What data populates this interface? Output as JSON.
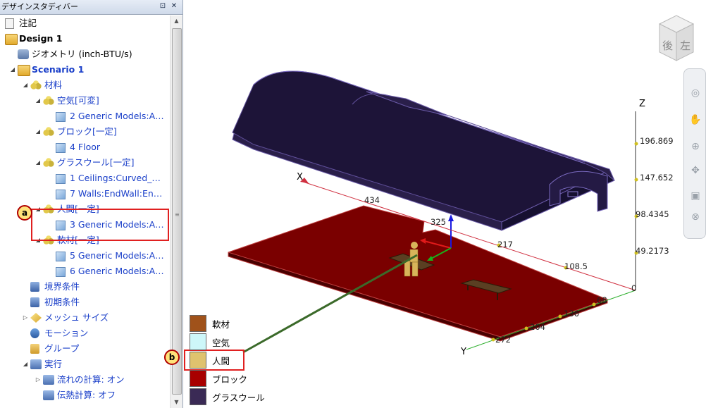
{
  "panel": {
    "title": "デザインスタディバー",
    "pin_icon": "pin-icon",
    "close_icon": "close-icon"
  },
  "tree": [
    {
      "label": "注記",
      "color": "black",
      "bold": false,
      "icon": "note-icon"
    },
    {
      "label": "Design 1",
      "color": "black",
      "bold": true,
      "icon": "design-folder-icon"
    },
    {
      "label": "ジオメトリ (inch-BTU/s)",
      "color": "black",
      "bold": false,
      "icon": "geometry-icon"
    },
    {
      "label": "Scenario 1",
      "color": "blue",
      "bold": true,
      "icon": "scenario-folder-icon"
    },
    {
      "label": "材料",
      "color": "blue",
      "bold": false,
      "icon": "materials-icon"
    },
    {
      "label": "空気[可変]",
      "color": "blue",
      "bold": false,
      "icon": "material-icon"
    },
    {
      "label": "2 Generic Models:A…",
      "color": "blue",
      "bold": false,
      "icon": "part-cube-icon"
    },
    {
      "label": "ブロック[一定]",
      "color": "blue",
      "bold": false,
      "icon": "material-icon"
    },
    {
      "label": "4 Floor",
      "color": "blue",
      "bold": false,
      "icon": "part-cube-icon"
    },
    {
      "label": "グラスウール[一定]",
      "color": "blue",
      "bold": false,
      "icon": "material-icon"
    },
    {
      "label": "1 Ceilings:Curved_…",
      "color": "blue",
      "bold": false,
      "icon": "part-cube-icon"
    },
    {
      "label": "7 Walls:EndWall:En…",
      "color": "blue",
      "bold": false,
      "icon": "part-cube-icon"
    },
    {
      "label": "人間[一定]",
      "color": "blue",
      "bold": false,
      "icon": "material-icon"
    },
    {
      "label": "3 Generic Models:A…",
      "color": "blue",
      "bold": false,
      "icon": "part-cube-icon"
    },
    {
      "label": "軟材[一定]",
      "color": "blue",
      "bold": false,
      "icon": "material-icon"
    },
    {
      "label": "5 Generic Models:A…",
      "color": "blue",
      "bold": false,
      "icon": "part-cube-icon"
    },
    {
      "label": "6 Generic Models:A…",
      "color": "blue",
      "bold": false,
      "icon": "part-cube-icon"
    },
    {
      "label": "境界条件",
      "color": "blue",
      "bold": false,
      "icon": "boundary-conditions-icon"
    },
    {
      "label": "初期条件",
      "color": "blue",
      "bold": false,
      "icon": "initial-conditions-icon"
    },
    {
      "label": "メッシュ サイズ",
      "color": "blue",
      "bold": false,
      "icon": "mesh-size-icon"
    },
    {
      "label": "モーション",
      "color": "blue",
      "bold": false,
      "icon": "motion-icon"
    },
    {
      "label": "グループ",
      "color": "blue",
      "bold": false,
      "icon": "group-icon"
    },
    {
      "label": "実行",
      "color": "blue",
      "bold": false,
      "icon": "run-icon"
    },
    {
      "label": "流れの計算: オン",
      "color": "blue",
      "bold": false,
      "icon": "flow-icon"
    },
    {
      "label": "伝熱計算: オフ",
      "color": "blue",
      "bold": false,
      "icon": "heat-transfer-icon"
    }
  ],
  "legend": [
    {
      "label": "軟材",
      "color": "#a0521a"
    },
    {
      "label": "空気",
      "color": "#cdf7f9"
    },
    {
      "label": "人間",
      "color": "#dfc26e"
    },
    {
      "label": "ブロック",
      "color": "#a80000"
    },
    {
      "label": "グラスウール",
      "color": "#3a2a55"
    }
  ],
  "annotations": {
    "a": "a",
    "b": "b"
  },
  "axes": {
    "x_label": "X",
    "y_label": "Y",
    "z_label": "Z",
    "x_ticks": [
      "434",
      "325",
      "217",
      "108.5",
      "0"
    ],
    "y_ticks": [
      "68",
      "136",
      "204",
      "272"
    ],
    "z_ticks": [
      "196.869",
      "147.652",
      "98.4345",
      "49.2173"
    ]
  },
  "viewcube": {
    "face_front": "後",
    "face_side": "左"
  },
  "colors": {
    "floor": "#7a0000",
    "roof": "#1d1438",
    "highlight_box": "#e02020",
    "leader_line": "#3b6a2a"
  }
}
